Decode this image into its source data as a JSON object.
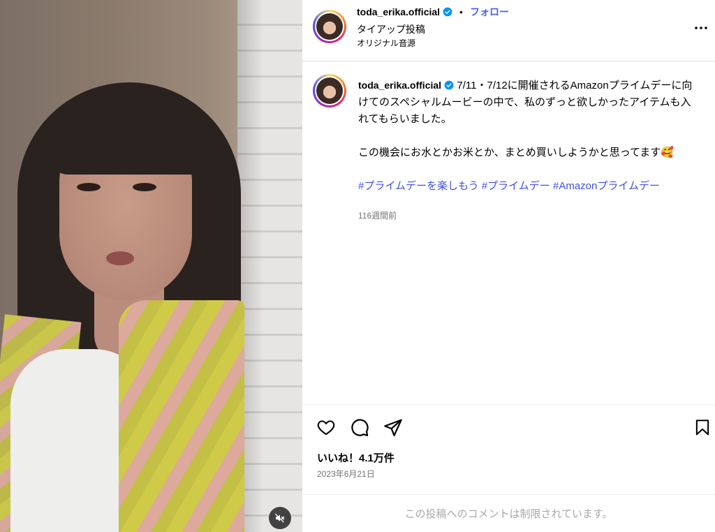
{
  "post": {
    "username": "toda_erika.official",
    "separator": "•",
    "follow_label": "フォロー",
    "subtitle": "タイアップ投稿",
    "audio": "オリジナル音源",
    "more_icon": "more-horizontal-icon"
  },
  "caption": {
    "username": "toda_erika.official",
    "paragraph1": "7/11・7/12に開催されるAmazonプライムデーに向けてのスペシャルムービーの中で、私のずっと欲しかったアイテムも入れてもらいました。",
    "paragraph2": "この機会にお水とかお米とか、まとめ買いしようかと思ってます🥰",
    "hashtags": [
      "#プライムデーを楽しもう",
      "#プライムデー",
      "#Amazonプライムデー"
    ],
    "time_ago": "116週間前"
  },
  "actions": {
    "likes": "いいね！4.1万件",
    "date": "2023年6月21日"
  },
  "footer": {
    "comments_disabled": "この投稿へのコメントは制限されています。"
  },
  "colors": {
    "link": "#4a5df0",
    "verified": "#0095f6",
    "muted_text": "#737373"
  }
}
